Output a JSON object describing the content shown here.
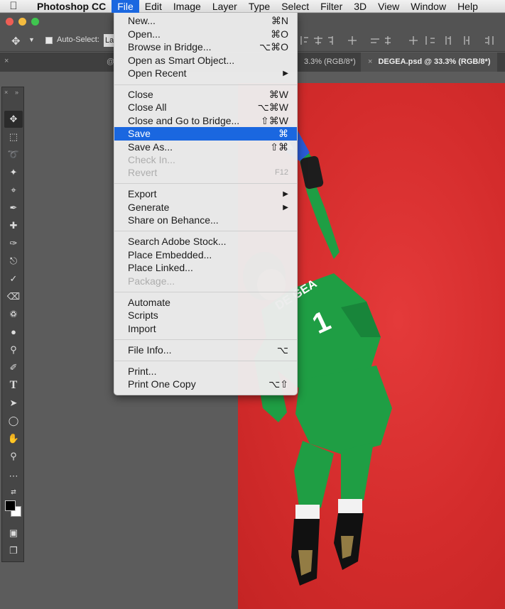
{
  "menubar": {
    "app_name": "Photoshop CC",
    "menus": [
      "File",
      "Edit",
      "Image",
      "Layer",
      "Type",
      "Select",
      "Filter",
      "3D",
      "View",
      "Window",
      "Help"
    ]
  },
  "options_bar": {
    "auto_select_label": "Auto-Select:",
    "auto_select_value": "La"
  },
  "tabs": [
    {
      "label": "3.3% (RGB/8*)"
    },
    {
      "label": "DEGEA.psd @ 33.3% (RGB/8*)"
    }
  ],
  "file_menu": {
    "items": [
      {
        "label": "New...",
        "shortcut": "⌘N"
      },
      {
        "label": "Open...",
        "shortcut": "⌘O"
      },
      {
        "label": "Browse in Bridge...",
        "shortcut": "⌥⌘O"
      },
      {
        "label": "Open as Smart Object..."
      },
      {
        "label": "Open Recent"
      },
      {
        "label": "Close",
        "shortcut": "⌘W"
      },
      {
        "label": "Close All",
        "shortcut": "⌥⌘W"
      },
      {
        "label": "Close and Go to Bridge...",
        "shortcut": "⇧⌘W"
      },
      {
        "label": "Save",
        "shortcut": "⌘"
      },
      {
        "label": "Save As...",
        "shortcut": "⇧⌘"
      },
      {
        "label": "Check In..."
      },
      {
        "label": "Revert",
        "shortcut": "F12"
      },
      {
        "label": "Export"
      },
      {
        "label": "Generate"
      },
      {
        "label": "Share on Behance..."
      },
      {
        "label": "Search Adobe Stock..."
      },
      {
        "label": "Place Embedded..."
      },
      {
        "label": "Place Linked..."
      },
      {
        "label": "Package..."
      },
      {
        "label": "Automate"
      },
      {
        "label": "Scripts"
      },
      {
        "label": "Import"
      },
      {
        "label": "File Info...",
        "shortcut": "⌥"
      },
      {
        "label": "Print..."
      },
      {
        "label": "Print One Copy",
        "shortcut": "⌥⇧"
      }
    ]
  },
  "jersey": {
    "name": "DE GEA",
    "number": "1"
  },
  "colors": {
    "menu_highlight": "#1a67e0",
    "canvas_red": "#d42c2c",
    "kit_green": "#1f9e44",
    "app_gray": "#535353"
  },
  "toolbox_icons": [
    "move-icon",
    "marquee-icon",
    "lasso-icon",
    "magic-wand-icon",
    "crop-icon",
    "eyedropper-icon",
    "healing-icon",
    "brush-icon",
    "stamp-icon",
    "history-brush-icon",
    "eraser-icon",
    "paint-bucket-icon",
    "blur-icon",
    "dodge-icon",
    "pen-icon",
    "type-icon",
    "path-select-icon",
    "ellipse-icon",
    "hand-icon",
    "zoom-icon",
    "more-icon",
    "color-swap-icon",
    "color-swatches-icon",
    "quick-mask-icon",
    "screen-mode-icon"
  ]
}
